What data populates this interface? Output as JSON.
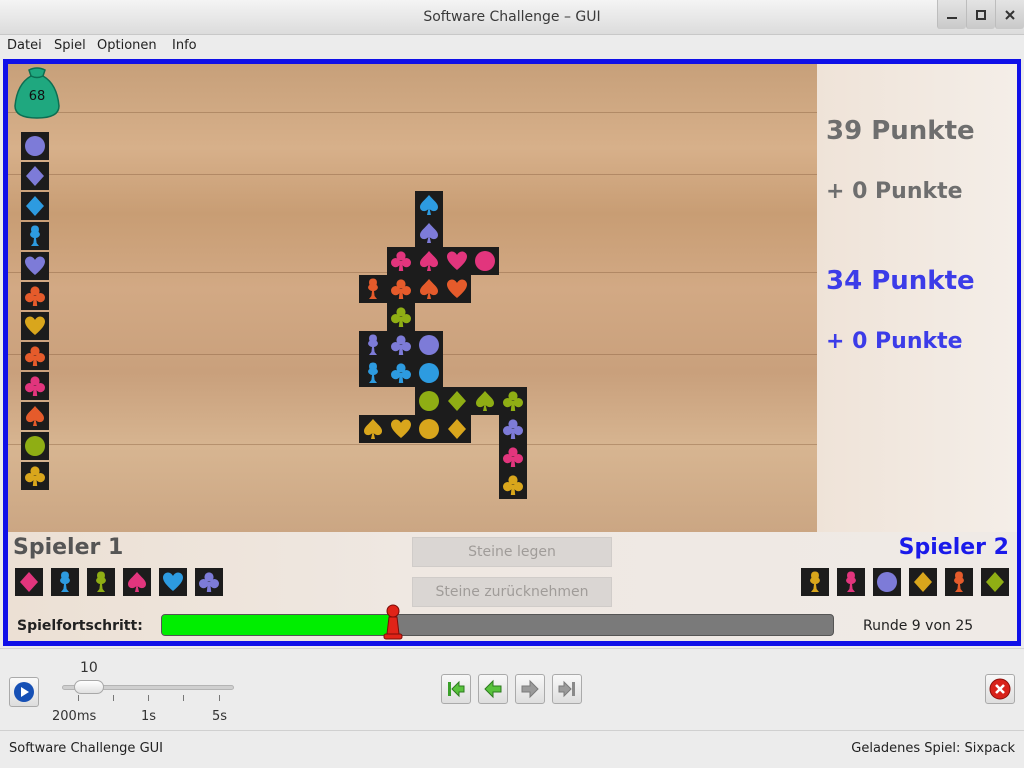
{
  "window": {
    "title": "Software Challenge – GUI"
  },
  "menu": [
    "Datei",
    "Spiel",
    "Optionen",
    "Info"
  ],
  "bag": {
    "count": "68"
  },
  "score": {
    "p1_total": "39 Punkte",
    "p1_delta": "+ 0 Punkte",
    "p2_total": "34 Punkte",
    "p2_delta": "+ 0 Punkte"
  },
  "colors": {
    "orange": "#e55b2b",
    "yellow": "#d9a61c",
    "green": "#8fae14",
    "blue": "#2d9be0",
    "lavender": "#7d7bd8",
    "magenta": "#e2357d",
    "p1": "#555555",
    "p2": "#1a1aea",
    "p1score": "#6e6e6e",
    "p2score": "#3c3ce8"
  },
  "stack": [
    {
      "s": "circle",
      "c": "lavender"
    },
    {
      "s": "diamond",
      "c": "lavender"
    },
    {
      "s": "diamond",
      "c": "blue"
    },
    {
      "s": "flower",
      "c": "blue"
    },
    {
      "s": "heart",
      "c": "lavender"
    },
    {
      "s": "club",
      "c": "orange"
    },
    {
      "s": "heart",
      "c": "yellow"
    },
    {
      "s": "club",
      "c": "orange"
    },
    {
      "s": "club",
      "c": "magenta"
    },
    {
      "s": "spade",
      "c": "orange"
    },
    {
      "s": "circle",
      "c": "green"
    },
    {
      "s": "club",
      "c": "yellow"
    }
  ],
  "board": [
    {
      "col": 0,
      "row": 0,
      "s": "spade",
      "c": "blue"
    },
    {
      "col": 0,
      "row": 1,
      "s": "spade",
      "c": "lavender"
    },
    {
      "col": -1,
      "row": 2,
      "s": "club",
      "c": "magenta"
    },
    {
      "col": 0,
      "row": 2,
      "s": "spade",
      "c": "magenta"
    },
    {
      "col": 1,
      "row": 2,
      "s": "heart",
      "c": "magenta"
    },
    {
      "col": 2,
      "row": 2,
      "s": "circle",
      "c": "magenta"
    },
    {
      "col": -2,
      "row": 3,
      "s": "flower",
      "c": "orange"
    },
    {
      "col": -1,
      "row": 3,
      "s": "club",
      "c": "orange"
    },
    {
      "col": 0,
      "row": 3,
      "s": "spade",
      "c": "orange"
    },
    {
      "col": 1,
      "row": 3,
      "s": "heart",
      "c": "orange"
    },
    {
      "col": -1,
      "row": 4,
      "s": "club",
      "c": "green"
    },
    {
      "col": -2,
      "row": 5,
      "s": "flower",
      "c": "lavender"
    },
    {
      "col": -1,
      "row": 5,
      "s": "club",
      "c": "lavender"
    },
    {
      "col": 0,
      "row": 5,
      "s": "circle",
      "c": "lavender"
    },
    {
      "col": -2,
      "row": 6,
      "s": "flower",
      "c": "blue"
    },
    {
      "col": -1,
      "row": 6,
      "s": "club",
      "c": "blue"
    },
    {
      "col": 0,
      "row": 6,
      "s": "circle",
      "c": "blue"
    },
    {
      "col": 0,
      "row": 7,
      "s": "circle",
      "c": "green"
    },
    {
      "col": 1,
      "row": 7,
      "s": "diamond",
      "c": "green"
    },
    {
      "col": 2,
      "row": 7,
      "s": "spade",
      "c": "green"
    },
    {
      "col": 3,
      "row": 7,
      "s": "club",
      "c": "green"
    },
    {
      "col": -2,
      "row": 8,
      "s": "spade",
      "c": "yellow"
    },
    {
      "col": -1,
      "row": 8,
      "s": "heart",
      "c": "yellow"
    },
    {
      "col": 0,
      "row": 8,
      "s": "circle",
      "c": "yellow"
    },
    {
      "col": 1,
      "row": 8,
      "s": "diamond",
      "c": "yellow"
    },
    {
      "col": 3,
      "row": 8,
      "s": "club",
      "c": "lavender"
    },
    {
      "col": 3,
      "row": 9,
      "s": "club",
      "c": "magenta"
    },
    {
      "col": 3,
      "row": 10,
      "s": "club",
      "c": "yellow"
    }
  ],
  "player1": {
    "name": "Spieler 1",
    "hand": [
      {
        "s": "diamond",
        "c": "magenta"
      },
      {
        "s": "flower",
        "c": "blue"
      },
      {
        "s": "flower",
        "c": "green"
      },
      {
        "s": "spade",
        "c": "magenta"
      },
      {
        "s": "heart",
        "c": "blue"
      },
      {
        "s": "club",
        "c": "lavender"
      }
    ]
  },
  "player2": {
    "name": "Spieler 2",
    "hand": [
      {
        "s": "flower",
        "c": "yellow"
      },
      {
        "s": "flower",
        "c": "magenta"
      },
      {
        "s": "circle",
        "c": "lavender"
      },
      {
        "s": "diamond",
        "c": "yellow"
      },
      {
        "s": "flower",
        "c": "orange"
      },
      {
        "s": "diamond",
        "c": "green"
      }
    ]
  },
  "buttons": {
    "place": "Steine legen",
    "undo": "Steine zurücknehmen"
  },
  "progress": {
    "label": "Spielfortschritt:",
    "fraction": 0.345,
    "round_text": "Runde 9 von 25"
  },
  "speed": {
    "value": "10",
    "ticks": [
      "200ms",
      "1s",
      "5s"
    ]
  },
  "status": {
    "left": "Software Challenge GUI",
    "right": "Geladenes Spiel: Sixpack"
  }
}
